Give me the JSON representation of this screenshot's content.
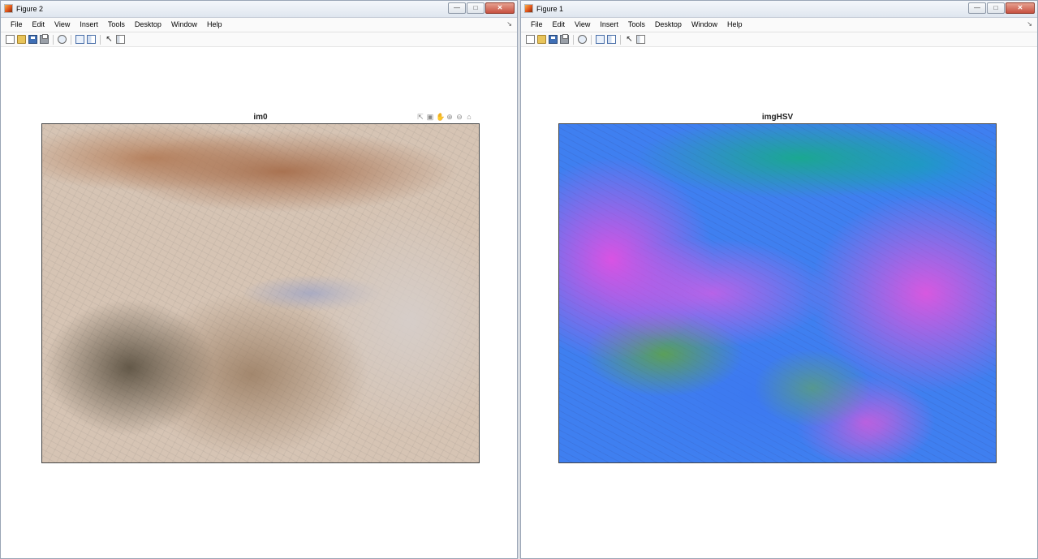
{
  "windows": [
    {
      "title": "Figure 2",
      "menu": [
        "File",
        "Edit",
        "View",
        "Insert",
        "Tools",
        "Desktop",
        "Window",
        "Help"
      ],
      "axes_title": "im0"
    },
    {
      "title": "Figure 1",
      "menu": [
        "File",
        "Edit",
        "View",
        "Insert",
        "Tools",
        "Desktop",
        "Window",
        "Help"
      ],
      "axes_title": "imgHSV"
    }
  ],
  "window_controls": {
    "minimize": "—",
    "maximize": "□",
    "close": "✕"
  },
  "icons": {
    "toolbar": [
      "new-figure-icon",
      "open-icon",
      "save-icon",
      "print-icon",
      "zoom-figure-icon",
      "link-plot-icon",
      "insert-colorbar-icon",
      "edit-plot-arrow-icon",
      "plot-browser-icon"
    ],
    "axes_toolbar": [
      "export-icon",
      "brush-icon",
      "pan-icon",
      "zoom-in-icon",
      "zoom-out-icon",
      "home-icon"
    ]
  },
  "colors": {
    "accent_titlebar": "#dfe6ef",
    "window_border": "#9aa6b6",
    "close_button": "#c75040"
  }
}
